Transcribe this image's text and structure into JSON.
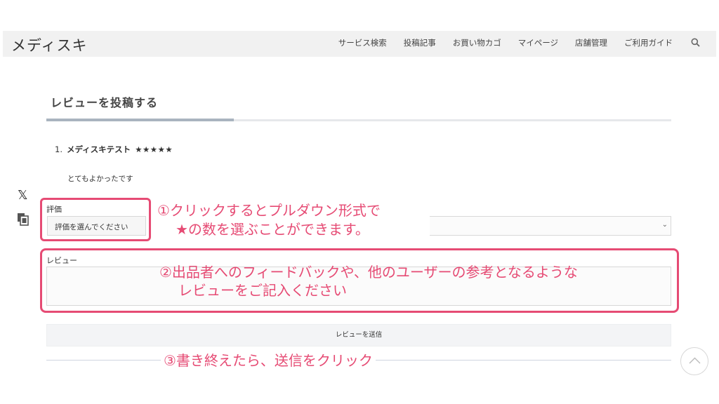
{
  "header": {
    "logo": "メディスキ",
    "nav": [
      "サービス検索",
      "投稿記事",
      "お買い物カゴ",
      "マイページ",
      "店舗管理",
      "ご利用ガイド"
    ],
    "search_icon": "search-icon"
  },
  "section": {
    "title": "レビューを投稿する"
  },
  "review": {
    "number": "1.",
    "name": "メディスキテスト",
    "stars": "★★★★★",
    "body": "とてもよかったです"
  },
  "sidebar": {
    "x_icon": "𝕏",
    "copy_icon": "copy-icon"
  },
  "form": {
    "rating_label": "評価",
    "rating_value": "評価を選んでください",
    "review_label": "レビュー",
    "review_value": "",
    "submit_label": "レビューを送信"
  },
  "annotations": {
    "step1_line1": "①クリックするとプルダウン形式で",
    "step1_line2": "★の数を選ぶことができます。",
    "step2_line1": "②出品者へのフィードバックや、他のユーザーの参考となるような",
    "step2_line2": "レビューをご記入ください",
    "step3": "③書き終えたら、送信をクリック"
  },
  "colors": {
    "accent": "#e64b74",
    "header_bg": "#f1f1f1",
    "button_bg": "#f3f4f6"
  }
}
